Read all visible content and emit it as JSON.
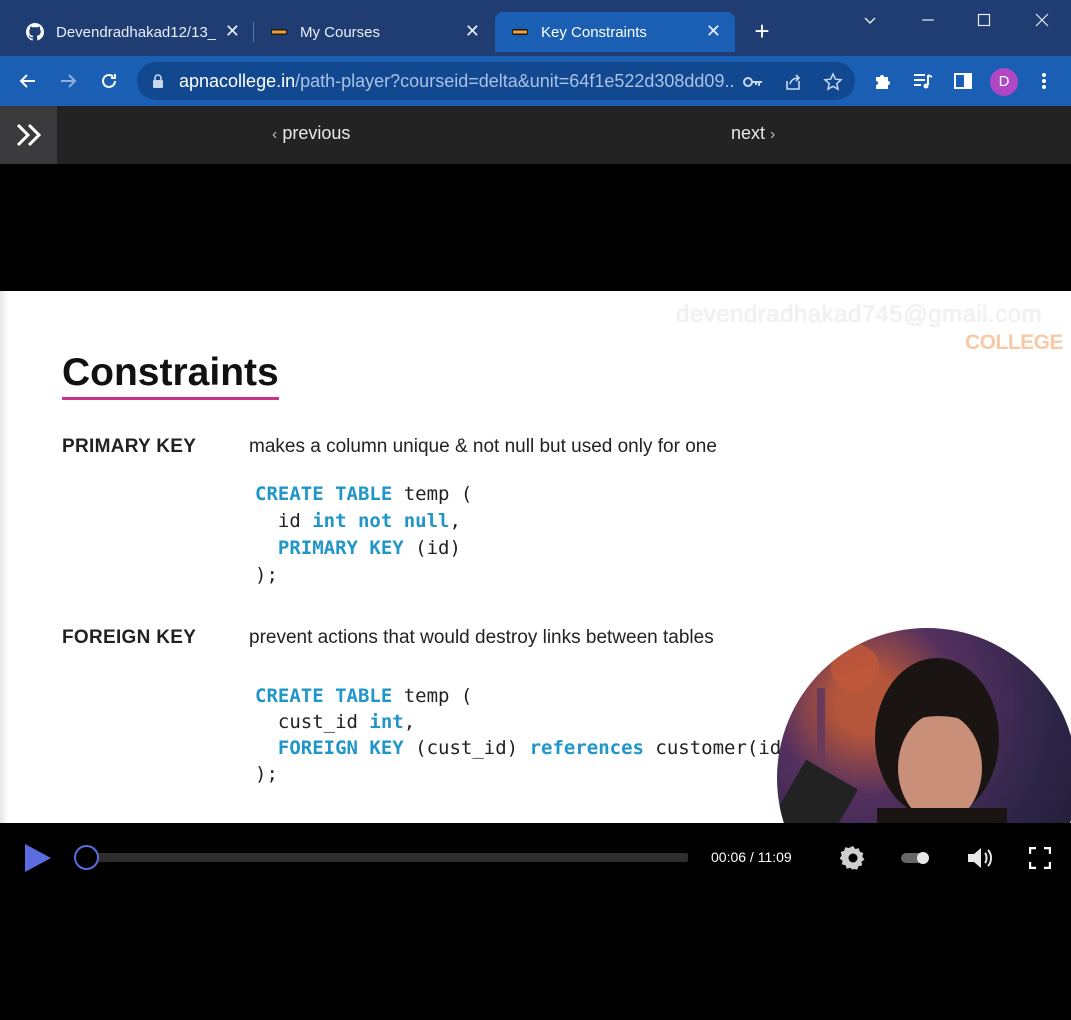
{
  "browser": {
    "tabs": [
      {
        "label": "Devendradhakad12/13_",
        "icon": "github-icon",
        "active": false
      },
      {
        "label": "My Courses",
        "icon": "apna-college-favicon",
        "active": false
      },
      {
        "label": "Key Constraints",
        "icon": "apna-college-favicon",
        "active": true
      }
    ],
    "url_host": "apnacollege.in",
    "url_path": "/path-player?courseid=delta&unit=64f1e522d308dd09...",
    "profile_initial": "D",
    "colors": {
      "tabbar": "#1f3d73",
      "toolbar": "#1a5fb4",
      "avatar": "#b247c6"
    }
  },
  "player_nav": {
    "previous_label": "previous",
    "next_label": "next"
  },
  "slide": {
    "watermark": "devendradhakad745@gmail.com",
    "brand": "COLLEGE",
    "title": "Constraints",
    "sections": [
      {
        "term": "PRIMARY KEY",
        "description": "makes a column unique & not null but used only for one",
        "code": [
          [
            {
              "t": "CREATE TABLE",
              "k": true
            },
            {
              "t": " temp (",
              "k": false
            }
          ],
          [
            {
              "t": "  id ",
              "k": false
            },
            {
              "t": "int not null",
              "k": true
            },
            {
              "t": ",",
              "k": false
            }
          ],
          [
            {
              "t": "  PRIMARY KEY",
              "k": true
            },
            {
              "t": " (id)",
              "k": false
            }
          ],
          [
            {
              "t": ");",
              "k": false
            }
          ]
        ]
      },
      {
        "term": "FOREIGN KEY",
        "description": "prevent actions that would destroy links between tables",
        "code": [
          [
            {
              "t": "CREATE TABLE",
              "k": true
            },
            {
              "t": " temp (",
              "k": false
            }
          ],
          [
            {
              "t": "  cust_id ",
              "k": false
            },
            {
              "t": "int",
              "k": true
            },
            {
              "t": ",",
              "k": false
            }
          ],
          [
            {
              "t": "  FOREIGN KEY",
              "k": true
            },
            {
              "t": " (cust_id) ",
              "k": false
            },
            {
              "t": "references",
              "k": true
            },
            {
              "t": " customer(id)",
              "k": false
            }
          ],
          [
            {
              "t": ");",
              "k": false
            }
          ]
        ]
      }
    ],
    "colors": {
      "keyword": "#2196c8",
      "title_underline": "#c8318c"
    }
  },
  "controls": {
    "time": "00:06 / 11:09",
    "progress": 0.009,
    "accent": "#5b6be0"
  }
}
